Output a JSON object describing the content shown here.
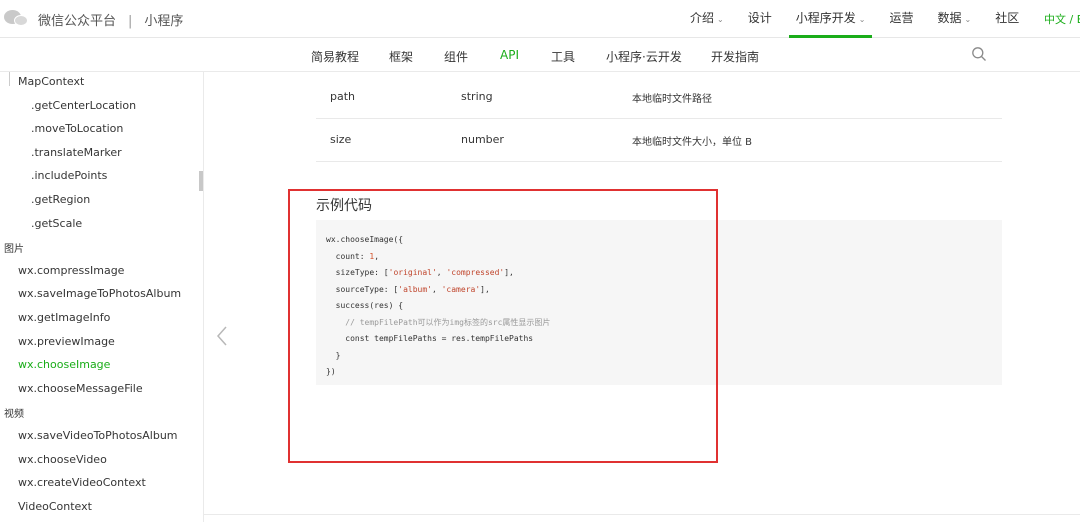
{
  "header": {
    "brand_name": "微信公众平台",
    "divider": "|",
    "product": "小程序",
    "nav": [
      {
        "label": "介绍",
        "has_caret": true
      },
      {
        "label": "设计",
        "has_caret": false
      },
      {
        "label": "小程序开发",
        "has_caret": true
      },
      {
        "label": "运营",
        "has_caret": false
      },
      {
        "label": "数据",
        "has_caret": true
      },
      {
        "label": "社区",
        "has_caret": false
      }
    ],
    "active_nav": "小程序开发",
    "language": "中文 / E"
  },
  "subnav": {
    "tabs": [
      "简易教程",
      "框架",
      "组件",
      "API",
      "工具",
      "小程序·云开发",
      "开发指南"
    ],
    "active_tab": "API"
  },
  "sidebar": {
    "items": [
      {
        "label": "MapContext",
        "level": 1
      },
      {
        "label": ".getCenterLocation",
        "level": 2
      },
      {
        "label": ".moveToLocation",
        "level": 2
      },
      {
        "label": ".translateMarker",
        "level": 2
      },
      {
        "label": ".includePoints",
        "level": 2
      },
      {
        "label": ".getRegion",
        "level": 2
      },
      {
        "label": ".getScale",
        "level": 2
      },
      {
        "label": "图片",
        "level": 0
      },
      {
        "label": "wx.compressImage",
        "level": 1
      },
      {
        "label": "wx.saveImageToPhotosAlbum",
        "level": 1
      },
      {
        "label": "wx.getImageInfo",
        "level": 1
      },
      {
        "label": "wx.previewImage",
        "level": 1
      },
      {
        "label": "wx.chooseImage",
        "level": 1,
        "active": true
      },
      {
        "label": "wx.chooseMessageFile",
        "level": 1
      },
      {
        "label": "视频",
        "level": 0
      },
      {
        "label": "wx.saveVideoToPhotosAlbum",
        "level": 1
      },
      {
        "label": "wx.chooseVideo",
        "level": 1
      },
      {
        "label": "wx.createVideoContext",
        "level": 1
      },
      {
        "label": "VideoContext",
        "level": 1
      }
    ]
  },
  "params_table": {
    "rows": [
      {
        "name": "path",
        "type": "string",
        "desc": "本地临时文件路径"
      },
      {
        "name": "size",
        "type": "number",
        "desc": "本地临时文件大小，单位 B"
      }
    ]
  },
  "example": {
    "title": "示例代码",
    "code_lines": [
      "wx.chooseImage({",
      "  count: 1,",
      "  sizeType: ['original', 'compressed'],",
      "  sourceType: ['album', 'camera'],",
      "  success(res) {",
      "    // tempFilePath可以作为img标签的src属性显示图片",
      "    const tempFilePaths = res.tempFilePaths",
      "  }",
      "})"
    ]
  },
  "colors": {
    "accent_green": "#1aad19",
    "highlight_red": "#e03131"
  }
}
